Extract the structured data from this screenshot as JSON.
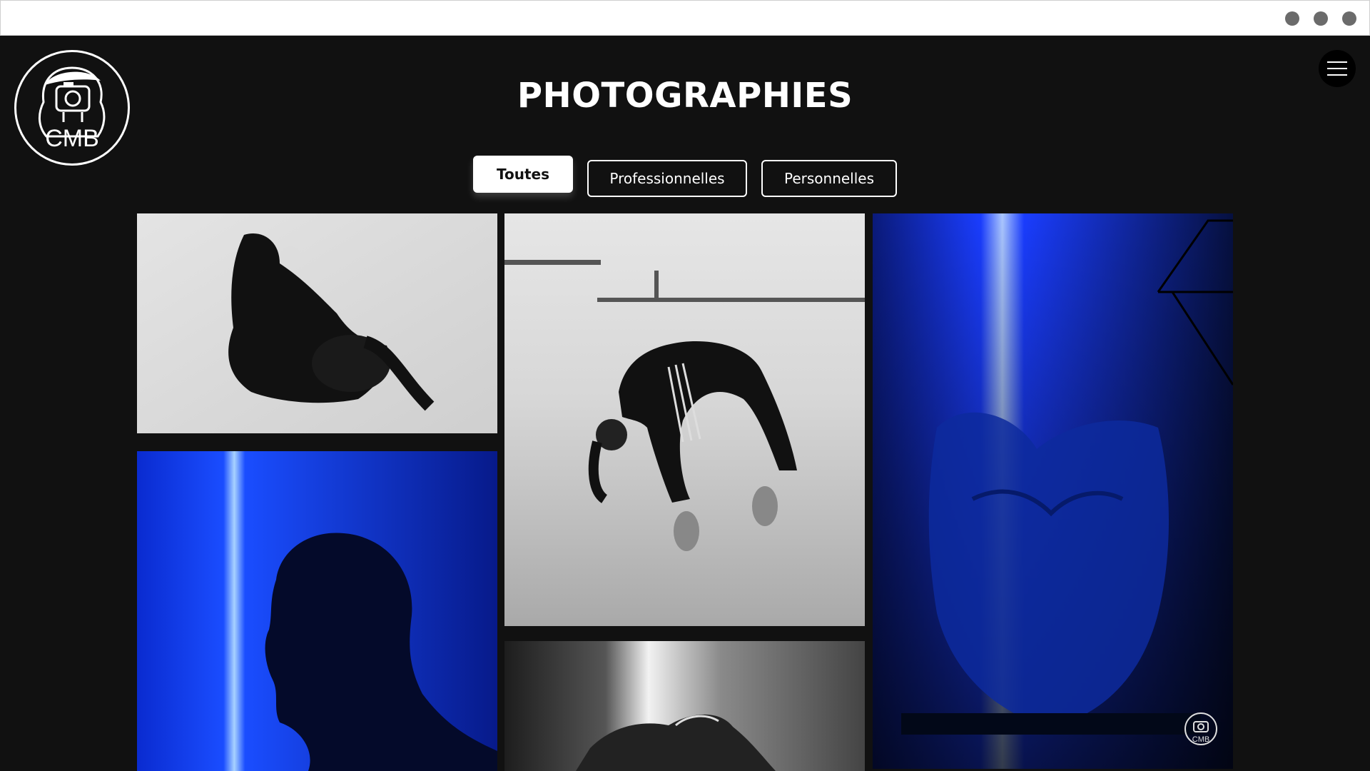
{
  "browser": {
    "window_controls": [
      "dot",
      "dot",
      "dot"
    ]
  },
  "header": {
    "logo": {
      "text": "CMB",
      "icon": "camera-portrait-logo"
    },
    "title": "PHOTOGRAPHIES",
    "menu_icon": "hamburger-menu-icon"
  },
  "filters": [
    {
      "label": "Toutes",
      "active": true
    },
    {
      "label": "Professionnelles",
      "active": false
    },
    {
      "label": "Personnelles",
      "active": false
    }
  ],
  "gallery": {
    "items": [
      {
        "name": "photo-dancer-floor",
        "tone": "grayscale"
      },
      {
        "name": "photo-dancer-backbend",
        "tone": "grayscale"
      },
      {
        "name": "photo-blue-torso",
        "tone": "blue"
      },
      {
        "name": "photo-blue-profile",
        "tone": "blue"
      },
      {
        "name": "photo-grayscale-face",
        "tone": "grayscale"
      }
    ],
    "watermark_text": "CMB"
  },
  "colors": {
    "background": "#111111",
    "accent_blue": "#1a3dff",
    "text": "#ffffff"
  }
}
